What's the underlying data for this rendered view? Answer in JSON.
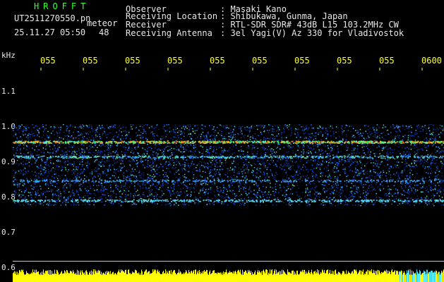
{
  "header": {
    "brand": "HROFFT",
    "filename": "UT2511270550.pn",
    "meteor_label": "meteor",
    "datetime": "25.11.27 05:50",
    "count": "48",
    "fields": [
      {
        "label": "Observer",
        "value": ": Masaki Kano"
      },
      {
        "label": "Receiving Location",
        "value": ": Shibukawa, Gunma, Japan"
      },
      {
        "label": "Receiver",
        "value": ": RTL-SDR SDR# 43dB L15 103.2MHz CW"
      },
      {
        "label": "Receiving Antenna",
        "value": ": 3el Yagi(V) Az 330 for Vladivostok"
      }
    ]
  },
  "axis": {
    "unit": "kHz",
    "y_ticks": [
      "1.1",
      "1.0",
      "0.9",
      "0.8",
      "0.7",
      "0.6"
    ],
    "time_ticks": [
      "055",
      "055",
      "055",
      "055",
      "055",
      "055",
      "055",
      "055",
      "055",
      "0600"
    ]
  },
  "colors": {
    "background": "#000000",
    "text": "#e8e8e8",
    "time_labels": "#ffff33",
    "brand": "#33ff33",
    "echo_strong": "#ffcc00",
    "signal_bar": "#ffff00"
  }
}
